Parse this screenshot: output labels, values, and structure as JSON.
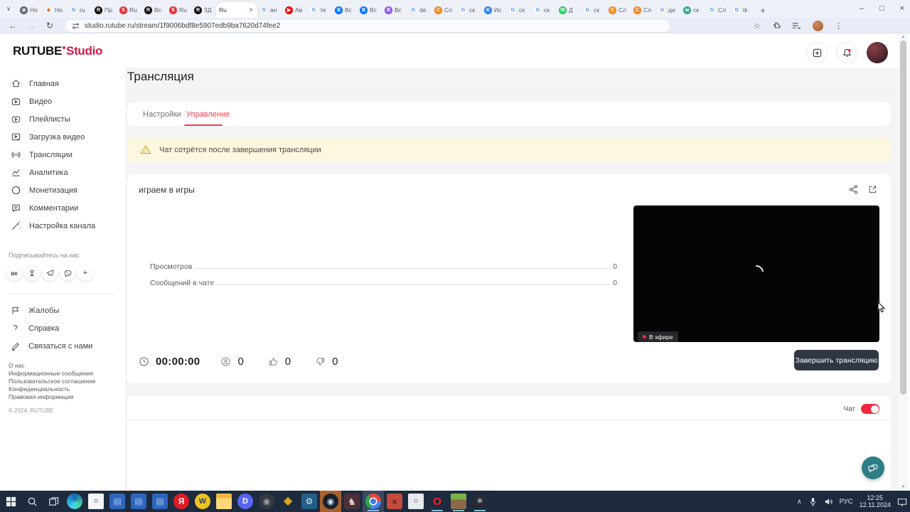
{
  "colors": {
    "accent_red": "#ef3f52",
    "button_dark": "#2e3742",
    "warning_bg": "#fcf7df",
    "fab_teal": "#2e7e86",
    "live_red": "#f3283f",
    "taskbar_bg": "#1e2b3e"
  },
  "browser": {
    "tab_search_glyph": "∨",
    "new_tab_glyph": "+",
    "window_controls": {
      "minimize": "–",
      "maximize": "□",
      "close": "×"
    },
    "active_tab": {
      "label": "Ru",
      "close_glyph": "×"
    },
    "tabs_before": [
      {
        "g": "◉",
        "bg": "#5a646e",
        "c": "#cfd6dd",
        "label": "Но"
      },
      {
        "g": "◆",
        "bg": "#fff",
        "c": "#e8732a",
        "label": "Но"
      },
      {
        "g": "G",
        "bg": "#fff",
        "c": "#4285f4",
        "label": "ru"
      },
      {
        "g": "R",
        "bg": "#111",
        "c": "#fff",
        "label": "Пр"
      },
      {
        "g": "S",
        "bg": "#e5333c",
        "c": "#fff",
        "label": "Ru"
      },
      {
        "g": "R",
        "bg": "#111",
        "c": "#fff",
        "label": "Вс"
      },
      {
        "g": "S",
        "bg": "#e5333c",
        "c": "#fff",
        "label": "Ru"
      },
      {
        "g": "R",
        "bg": "#111",
        "c": "#fff",
        "label": "3Д"
      }
    ],
    "tabs_after": [
      {
        "g": "G",
        "bg": "#fff",
        "c": "#4285f4",
        "label": "ан"
      },
      {
        "g": "▶",
        "bg": "#f00",
        "c": "#fff",
        "label": "Ав"
      },
      {
        "g": "G",
        "bg": "#fff",
        "c": "#4285f4",
        "label": "те"
      },
      {
        "g": "B",
        "bg": "#0077ff",
        "c": "#fff",
        "label": "Вс"
      },
      {
        "g": "B",
        "bg": "#0077ff",
        "c": "#fff",
        "label": "Вс"
      },
      {
        "g": "B",
        "bg": "#8e58e8",
        "c": "#fff",
        "label": "Вс"
      },
      {
        "g": "G",
        "bg": "#fff",
        "c": "#4285f4",
        "label": "de"
      },
      {
        "g": "С",
        "bg": "#f5891f",
        "c": "#fff",
        "label": "Сл"
      },
      {
        "g": "G",
        "bg": "#fff",
        "c": "#4285f4",
        "label": "ск"
      },
      {
        "g": "K",
        "bg": "#2787f5",
        "c": "#fff",
        "label": "Ис"
      },
      {
        "g": "G",
        "bg": "#fff",
        "c": "#4285f4",
        "label": "ск"
      },
      {
        "g": "G",
        "bg": "#fff",
        "c": "#4285f4",
        "label": "ск"
      },
      {
        "g": "W",
        "bg": "#25d366",
        "c": "#fff",
        "label": "Д"
      },
      {
        "g": "G",
        "bg": "#fff",
        "c": "#4285f4",
        "label": "ск"
      },
      {
        "g": "С",
        "bg": "#f5891f",
        "c": "#fff",
        "label": "Сл"
      },
      {
        "g": "С",
        "bg": "#f5891f",
        "c": "#fff",
        "label": "Сл"
      },
      {
        "g": "G",
        "bg": "#fff",
        "c": "#4285f4",
        "label": "ди"
      },
      {
        "g": "м",
        "bg": "#3fa6a0",
        "c": "#fff",
        "label": "ск"
      },
      {
        "g": "G",
        "bg": "#fff",
        "c": "#4285f4",
        "label": "Сл"
      },
      {
        "g": "G",
        "bg": "#fff",
        "c": "#4285f4",
        "label": "tk"
      }
    ],
    "nav": {
      "back": "←",
      "forward": "→",
      "reload": "↻"
    },
    "url": "studio.rutube.ru/stream/1f9006bdf8e5907edb9ba7620d74fee2",
    "bookmark_star": "☆",
    "menu_dots": "⋮"
  },
  "header": {
    "logo_main": "RUTUBE",
    "logo_accent": "Studio"
  },
  "sidebar": {
    "items": [
      {
        "label": "Главная"
      },
      {
        "label": "Видео"
      },
      {
        "label": "Плейлисты"
      },
      {
        "label": "Загрузка видео"
      },
      {
        "label": "Трансляции"
      },
      {
        "label": "Аналитика"
      },
      {
        "label": "Монетизация"
      },
      {
        "label": "Комментарии"
      },
      {
        "label": "Настройка канала"
      }
    ],
    "subscribe_title": "Подписывайтесь на нас",
    "social_vk": "вк",
    "social_plus": "+",
    "support": [
      {
        "label": "Жалобы"
      },
      {
        "label": "Справка"
      },
      {
        "label": "Связаться с нами"
      }
    ],
    "footer_links": [
      "О нас",
      "Информационные сообщения",
      "Пользовательское соглашение",
      "Конфиденциальность",
      "Правовая информация"
    ],
    "copyright": "© 2024, RUTUBE"
  },
  "page": {
    "title": "Трансляция",
    "tab_settings": "Настройки",
    "tab_control": "Управление",
    "warning": "Чат сотрётся после завершения трансляции",
    "stream_title": "играем в игры",
    "stats_rows": [
      {
        "label": "Просмотров",
        "value": "0"
      },
      {
        "label": "Сообщений в чате",
        "value": "0"
      }
    ],
    "live_badge": "В эфире",
    "counters": {
      "duration": "00:00:00",
      "comments": "0",
      "likes": "0",
      "dislikes": "0"
    },
    "finish_button": "Завершить трансляцию",
    "chat_label": "Чат"
  },
  "taskbar": {
    "icons": [
      {
        "g": "",
        "bg": "conic-gradient(from 200deg,#3fd3f6,#1467b3 45%,#45d89b 80%,#3fd3f6)",
        "r": "50%"
      },
      {
        "g": "≡",
        "c": "#7d8aa0",
        "bg": "#f2f4f6",
        "r": "2px",
        "fs": "11px"
      },
      {
        "g": "▤",
        "c": "#a8c8f0",
        "bg": "#2d66bd",
        "r": "3px",
        "fs": "12px"
      },
      {
        "g": "▤",
        "c": "#a8c8f0",
        "bg": "#2d66bd",
        "r": "3px",
        "fs": "12px"
      },
      {
        "g": "▤",
        "c": "#a8c8f0",
        "bg": "#2d66bd",
        "r": "3px",
        "fs": "12px"
      },
      {
        "g": "Я",
        "c": "#fff",
        "bg": "#e01a24",
        "r": "50%",
        "fs": "12px",
        "fw": "700"
      },
      {
        "g": "W",
        "c": "#23418f",
        "bg": "#efc31b",
        "r": "50%",
        "fs": "11px",
        "fw": "700"
      },
      {
        "g": "",
        "bg": "linear-gradient(#f3b73c 0 30%,#fad87c 30% 100%)",
        "r": "2px"
      },
      {
        "g": "D",
        "c": "#fff",
        "bg": "#5865f2",
        "r": "50%",
        "fs": "11px",
        "fw": "700"
      },
      {
        "g": "◉",
        "c": "#9aa0a6",
        "bg": "#35393f",
        "r": "50%",
        "fs": "12px"
      },
      {
        "g": "◆",
        "c": "#d9a61c",
        "fs": "16px"
      },
      {
        "g": "⚙",
        "c": "#d6e8f5",
        "bg": "#235e88",
        "r": "3px",
        "fs": "12px"
      },
      {
        "wrap": "#a9612c",
        "g": "◉",
        "c": "#cfe2f2",
        "bg": "#17202d",
        "r": "50%",
        "fs": "12px"
      },
      {
        "g": "♞",
        "c": "#e6d4c8",
        "bg": "#4e2f38",
        "r": "3px",
        "fs": "13px"
      },
      {
        "wrap": "#39485c",
        "bar": "#88b6d8",
        "g": "",
        "bg": "radial-gradient(circle at 50% 50%,#3f7de0 0 4px,#fff 4px 5.5px,rgba(0,0,0,0) 5.5px),conic-gradient(from -40deg,#e8453c 0 130deg,#4285f4 130deg 245deg,#30a352 245deg 360deg)",
        "r": "50%"
      },
      {
        "g": "×",
        "c": "#64221a",
        "bg": "#c44b3d",
        "r": "3px",
        "fs": "13px",
        "fw": "700"
      },
      {
        "g": "≡",
        "c": "#8b95a2",
        "bg": "#e7eaee",
        "r": "2px",
        "fs": "11px"
      },
      {
        "g": "O",
        "c": "#ff1b2d",
        "fs": "15px",
        "fw": "700",
        "bar": "#7fc0cf"
      },
      {
        "g": "",
        "bg": "linear-gradient(#7cb342 0 38%,#8a6a48 38% 100%)",
        "r": "2px",
        "bar": "#7fc0cf"
      },
      {
        "g": "✳",
        "c": "#e8e8e8",
        "bg": "#262b33",
        "r": "50%",
        "fs": "11px",
        "bar": "#7fc0cf"
      }
    ],
    "tray": {
      "chevron": "∧",
      "lang": "РУС",
      "time": "12:25",
      "date": "12.11.2024"
    }
  }
}
